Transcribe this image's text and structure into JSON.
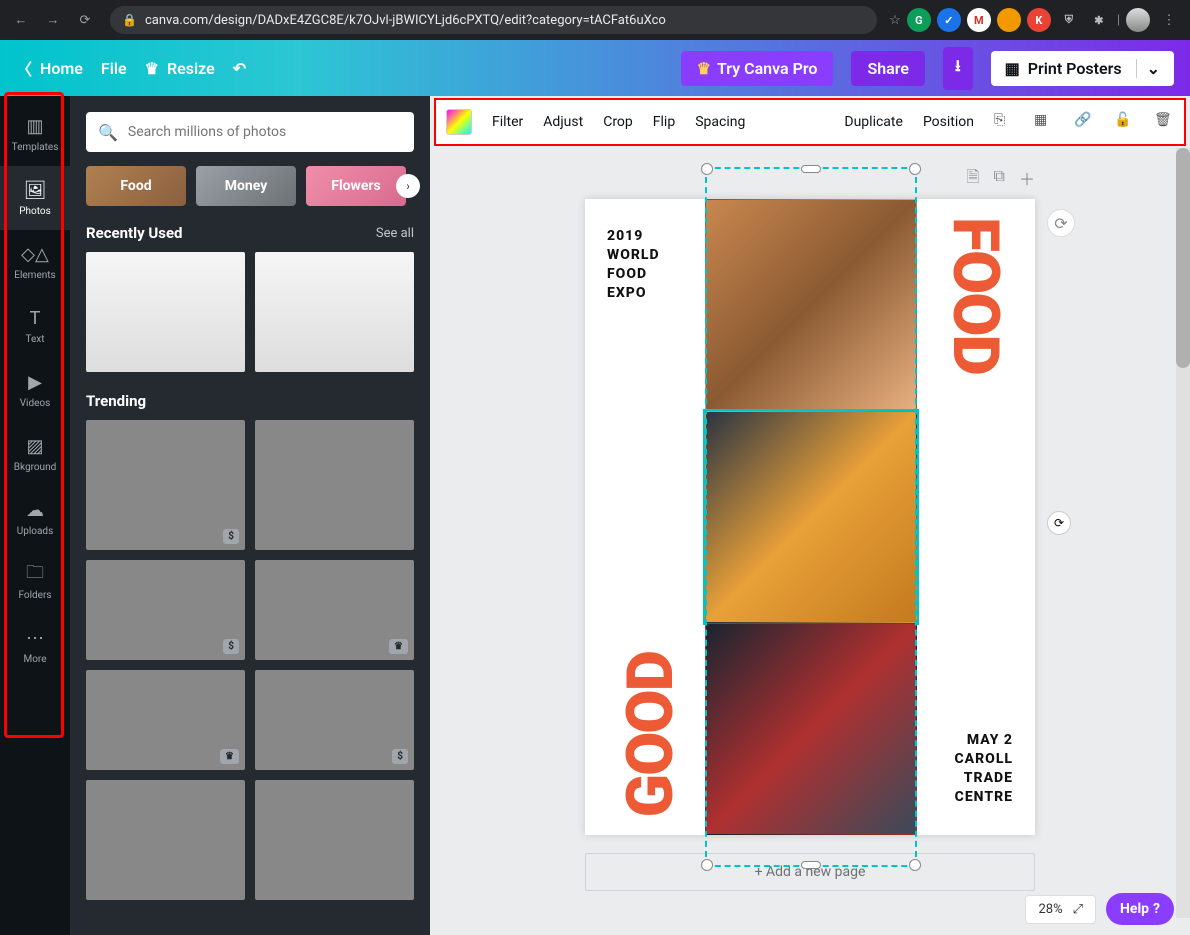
{
  "browser": {
    "url": "canva.com/design/DADxE4ZGC8E/k7OJvl-jBWICYLjd6cPXTQ/edit?category=tACFat6uXco"
  },
  "topbar": {
    "home": "Home",
    "file": "File",
    "resize": "Resize",
    "try_pro": "Try Canva Pro",
    "share": "Share",
    "print": "Print Posters"
  },
  "rail": {
    "items": [
      {
        "label": "Templates"
      },
      {
        "label": "Photos"
      },
      {
        "label": "Elements"
      },
      {
        "label": "Text"
      },
      {
        "label": "Videos"
      },
      {
        "label": "Bkground"
      },
      {
        "label": "Uploads"
      },
      {
        "label": "Folders"
      },
      {
        "label": "More"
      }
    ]
  },
  "panel": {
    "search_placeholder": "Search millions of photos",
    "chips": [
      "Food",
      "Money",
      "Flowers"
    ],
    "recent_title": "Recently Used",
    "see_all": "See all",
    "trending_title": "Trending"
  },
  "ctx": {
    "filter": "Filter",
    "adjust": "Adjust",
    "crop": "Crop",
    "flip": "Flip",
    "spacing": "Spacing",
    "duplicate": "Duplicate",
    "position": "Position"
  },
  "poster": {
    "tl_line1": "2019",
    "tl_line2": "WORLD",
    "tl_line3": "FOOD",
    "tl_line4": "EXPO",
    "v_food": "FOOD",
    "v_good": "GOOD",
    "br_line1": "MAY 2",
    "br_line2": "CAROLL",
    "br_line3": "TRADE",
    "br_line4": "CENTRE"
  },
  "add_page": "+ Add a new page",
  "zoom": "28%",
  "help": "Help"
}
